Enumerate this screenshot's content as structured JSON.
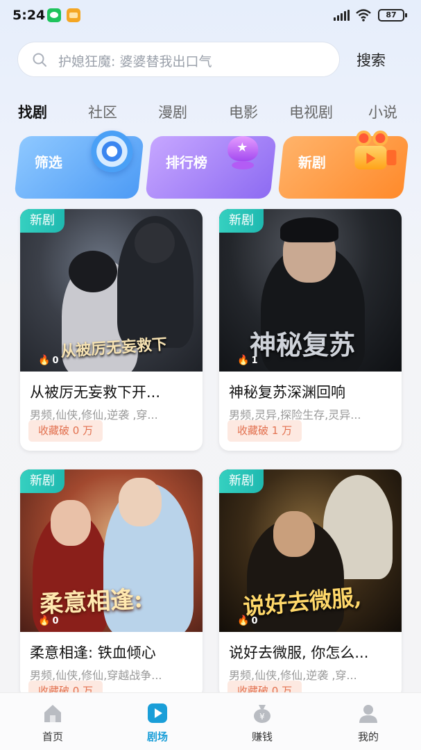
{
  "status_bar": {
    "time": "5:24",
    "battery": "87"
  },
  "search": {
    "placeholder": "护媳狂魔: 婆婆替我出口气",
    "button_label": "搜索"
  },
  "tabs": [
    "找剧",
    "社区",
    "漫剧",
    "电影",
    "电视剧",
    "小说"
  ],
  "active_tab": "找剧",
  "features": [
    {
      "label": "筛选",
      "icon": "target-icon"
    },
    {
      "label": "排行榜",
      "icon": "trophy-icon"
    },
    {
      "label": "新剧",
      "icon": "video-camera-icon"
    }
  ],
  "dramas": [
    {
      "badge": "新剧",
      "poster_text": "从被厉无妄救下",
      "heat": "0",
      "title": "从被厉无妄救下开...",
      "tags": "男频,仙侠,修仙,逆袭 ,穿...",
      "favorites": "收藏破 0 万"
    },
    {
      "badge": "新剧",
      "poster_text": "神秘复苏",
      "heat": "1",
      "title": "神秘复苏深渊回响",
      "tags": "男频,灵异,探险生存,灵异...",
      "favorites": "收藏破 1 万"
    },
    {
      "badge": "新剧",
      "poster_text": "柔意相逢:",
      "heat": "0",
      "title": "柔意相逢: 铁血倾心",
      "tags": "男频,仙侠,修仙,穿越战争...",
      "favorites": "收藏破 0 万"
    },
    {
      "badge": "新剧",
      "poster_text": "说好去微服,",
      "heat": "0",
      "title": "说好去微服, 你怎么...",
      "tags": "男频,仙侠,修仙,逆袭 ,穿...",
      "favorites": "收藏破 0 万"
    }
  ],
  "bottom_nav": [
    {
      "label": "首页",
      "icon": "home-icon"
    },
    {
      "label": "剧场",
      "icon": "theater-play-icon"
    },
    {
      "label": "赚钱",
      "icon": "money-bag-icon"
    },
    {
      "label": "我的",
      "icon": "user-icon"
    }
  ],
  "active_nav": "剧场",
  "colors": {
    "accent": "#1a9ed8",
    "badge": "#1fb9b0",
    "favorite_bg": "#fde9e1",
    "favorite_text": "#e2704e"
  }
}
